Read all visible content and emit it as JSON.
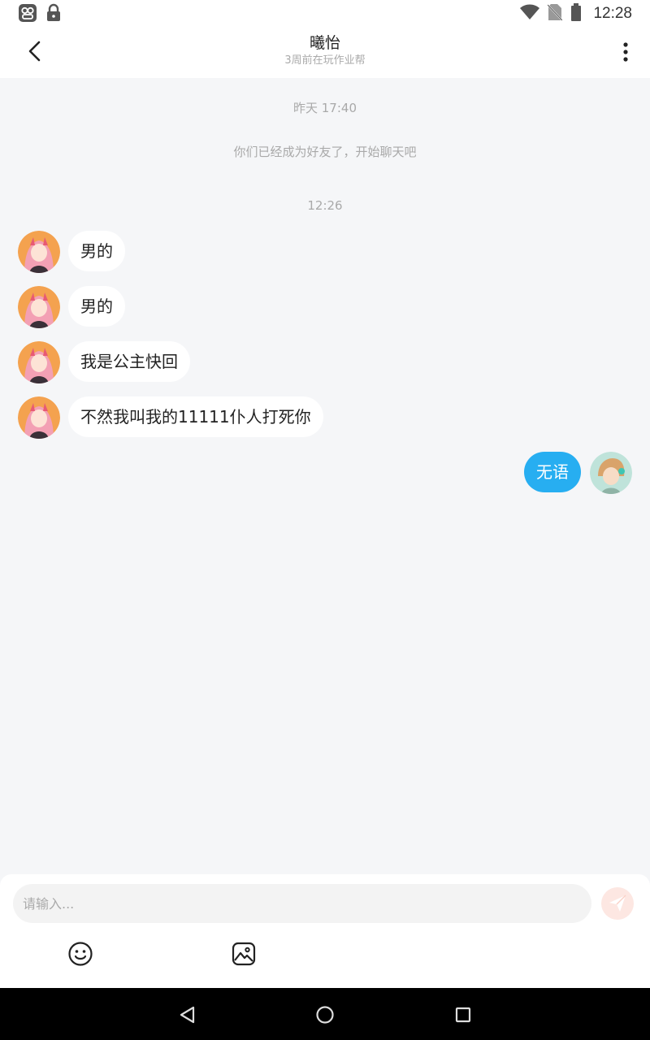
{
  "status_bar": {
    "time": "12:28",
    "icons": [
      "app-icon",
      "lock-icon",
      "wifi-icon",
      "no-sim-icon",
      "battery-icon"
    ]
  },
  "header": {
    "title": "曦怡",
    "subtitle": "3周前在玩作业帮",
    "back_icon": "back-arrow-icon",
    "more_icon": "more-vertical-icon"
  },
  "chat": {
    "timestamp_1": "昨天 17:40",
    "system_note": "你们已经成为好友了，开始聊天吧",
    "timestamp_2": "12:26",
    "messages": [
      {
        "from": "other",
        "text": "男的"
      },
      {
        "from": "other",
        "text": "男的"
      },
      {
        "from": "other",
        "text": "我是公主快回"
      },
      {
        "from": "other",
        "text": "不然我叫我的11111仆人打死你"
      },
      {
        "from": "me",
        "text": "无语"
      }
    ]
  },
  "composer": {
    "placeholder": "请输入...",
    "send_icon": "send-icon",
    "tools": [
      "emoji-icon",
      "image-icon"
    ]
  },
  "colors": {
    "accent": "#27aef1",
    "background": "#f5f6f8",
    "bubble_in": "#ffffff",
    "send_button": "#fde7e2"
  },
  "nav_bar": {
    "icons": [
      "nav-back-icon",
      "nav-home-icon",
      "nav-recents-icon"
    ]
  }
}
